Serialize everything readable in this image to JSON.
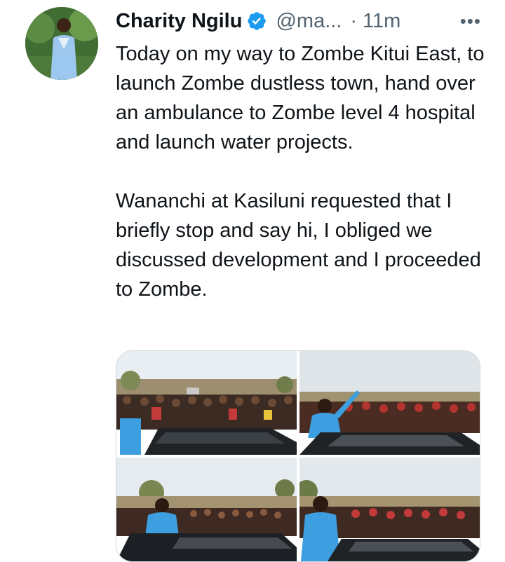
{
  "tweet": {
    "author_name": "Charity Ngilu",
    "handle": "@ma...",
    "separator": "·",
    "time": "11m",
    "more_label": "•••",
    "paragraphs": [
      "Today on my way to Zombe Kitui East, to launch Zombe dustless town, hand over an ambulance to Zombe level 4 hospital and launch water projects.",
      "Wananchi at Kasiluni requested that I briefly stop and say hi, I obliged we discussed development and I proceeded to Zombe."
    ]
  },
  "colors": {
    "verified": "#1d9bf0",
    "secondary_text": "#536471",
    "outfit": "#3d9fe0"
  },
  "icons": {
    "verified": "verified-badge-icon",
    "more": "more-options-icon"
  }
}
